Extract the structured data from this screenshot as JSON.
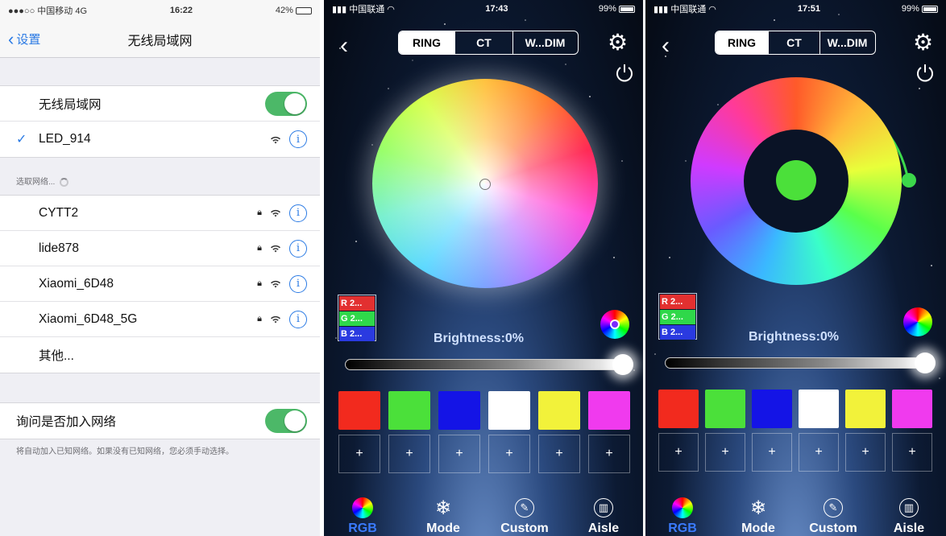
{
  "settings": {
    "status": {
      "carrier": "●●●○○ 中国移动 4G",
      "time": "16:22",
      "battery": "42%"
    },
    "nav": {
      "back": "设置",
      "title": "无线局域网"
    },
    "wifi_toggle_label": "无线局域网",
    "connected": "LED_914",
    "choose_label": "选取网络...",
    "networks": [
      "CYTT2",
      "lide878",
      "Xiaomi_6D48",
      "Xiaomi_6D48_5G"
    ],
    "other": "其他...",
    "ask_label": "询问是否加入网络",
    "ask_note": "将自动加入已知网络。如果没有已知网络，您必须手动选择。"
  },
  "app1": {
    "status": {
      "carrier": "中国联通",
      "time": "17:43",
      "battery": "99%"
    },
    "tabs_top": [
      "RING",
      "CT",
      "W...DIM"
    ],
    "rgb": [
      "R 2...",
      "G 2...",
      "B 2..."
    ],
    "brightness": "Brightness:0%",
    "swatches": [
      "#f22a1e",
      "#4be03a",
      "#1414e6",
      "#ffffff",
      "#f2f23a",
      "#f03aee"
    ],
    "plus": "+",
    "bottom_tabs": [
      "RGB",
      "Mode",
      "Custom",
      "Aisle"
    ]
  },
  "app2": {
    "status": {
      "carrier": "中国联通",
      "time": "17:51",
      "battery": "99%"
    },
    "tabs_top": [
      "RING",
      "CT",
      "W...DIM"
    ],
    "rgb": [
      "R 2...",
      "G 2...",
      "B 2..."
    ],
    "brightness": "Brightness:0%",
    "swatches": [
      "#f22a1e",
      "#4be03a",
      "#1414e6",
      "#ffffff",
      "#f2f23a",
      "#f03aee"
    ],
    "plus": "+",
    "bottom_tabs": [
      "RGB",
      "Mode",
      "Custom",
      "Aisle"
    ]
  }
}
